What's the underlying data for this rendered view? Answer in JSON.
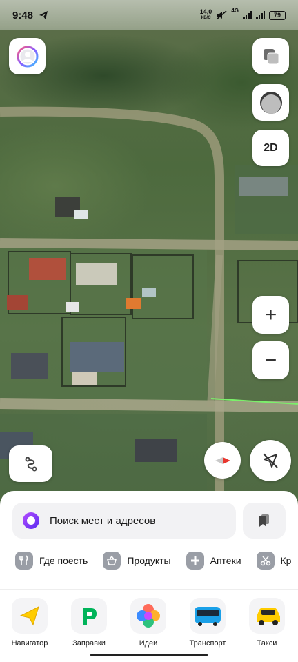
{
  "status_bar": {
    "time": "9:48",
    "speed_value": "14,0",
    "speed_unit": "КБ/С",
    "network": "4G",
    "battery": "79"
  },
  "map_controls": {
    "profile_icon": "avatar-ring-icon",
    "layers_icon": "layers-icon",
    "style_icon": "map-style-icon",
    "view_mode_label": "2D",
    "zoom_in_label": "+",
    "zoom_out_label": "−",
    "route_icon": "route-icon",
    "compass_icon": "compass-icon",
    "location_icon": "location-off-icon"
  },
  "search": {
    "placeholder": "Поиск мест и адресов",
    "assistant_icon": "alice-icon",
    "bookmarks_icon": "bookmarks-icon"
  },
  "categories": [
    {
      "label": "Где поесть",
      "icon": "fork-knife-icon"
    },
    {
      "label": "Продукты",
      "icon": "basket-icon"
    },
    {
      "label": "Аптеки",
      "icon": "cross-icon"
    },
    {
      "label": "Кр",
      "icon": "scissors-icon"
    }
  ],
  "apps": [
    {
      "label": "Навигатор",
      "icon": "navigator-arrow-icon"
    },
    {
      "label": "Заправки",
      "icon": "fuel-p-icon"
    },
    {
      "label": "Идеи",
      "icon": "ideas-flower-icon"
    },
    {
      "label": "Транспорт",
      "icon": "bus-icon"
    },
    {
      "label": "Такси",
      "icon": "taxi-car-icon"
    }
  ],
  "colors": {
    "accent_purple": "#7b3cf0",
    "compass_red": "#e8362e",
    "navigator_yellow": "#ffcc00",
    "fuel_green": "#00b45a",
    "bus_blue": "#1aa0e8"
  }
}
